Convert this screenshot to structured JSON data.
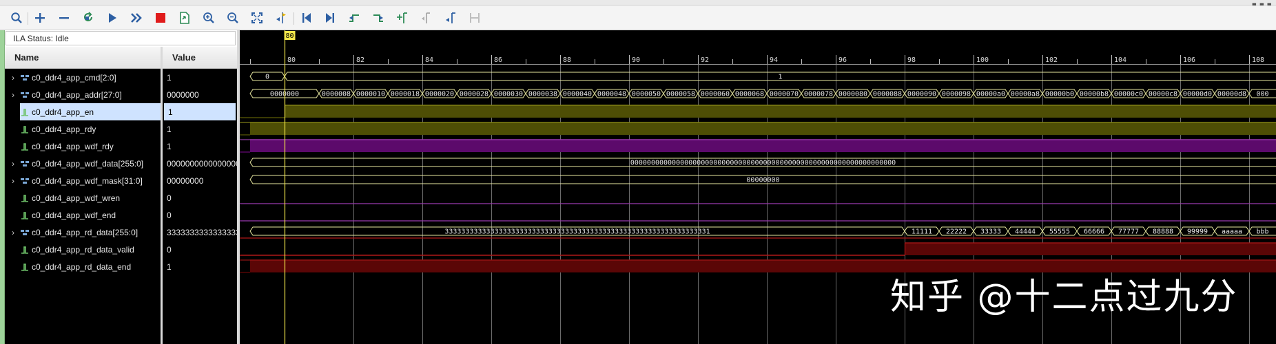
{
  "toolbar": {
    "buttons": [
      {
        "name": "search-icon",
        "tip": "Search"
      },
      {
        "name": "zoom-in-plus-icon",
        "tip": "Add"
      },
      {
        "name": "minus-icon",
        "tip": "Remove"
      },
      {
        "name": "refresh-icon",
        "tip": "Refresh"
      },
      {
        "name": "run-trigger-icon",
        "tip": "Run Trigger"
      },
      {
        "name": "run-immediate-icon",
        "tip": "Run Immediate"
      },
      {
        "name": "stop-icon",
        "tip": "Stop"
      },
      {
        "name": "export-icon",
        "tip": "Export"
      },
      {
        "name": "zoom-in-icon",
        "tip": "Zoom In"
      },
      {
        "name": "zoom-out-icon",
        "tip": "Zoom Out"
      },
      {
        "name": "zoom-fit-icon",
        "tip": "Zoom Fit"
      },
      {
        "name": "go-to-cursor-icon",
        "tip": "Go To Cursor"
      },
      {
        "name": "go-to-start-icon",
        "tip": "Go To Time 0"
      },
      {
        "name": "go-to-end-icon",
        "tip": "Go To Last Time"
      },
      {
        "name": "previous-transition-icon",
        "tip": "Previous Transition"
      },
      {
        "name": "next-transition-icon",
        "tip": "Next Transition"
      },
      {
        "name": "add-marker-icon",
        "tip": "Add Marker"
      },
      {
        "name": "previous-marker-icon",
        "tip": "Previous Marker"
      },
      {
        "name": "next-marker-icon",
        "tip": "Next Marker"
      },
      {
        "name": "swap-cursors-icon",
        "tip": "Swap Cursors"
      }
    ]
  },
  "status": {
    "label": "ILA Status:",
    "value": "Idle"
  },
  "columns": {
    "name": "Name",
    "value": "Value"
  },
  "signals": [
    {
      "name": "c0_ddr4_app_cmd[2:0]",
      "value": "1",
      "bus": true
    },
    {
      "name": "c0_ddr4_app_addr[27:0]",
      "value": "0000000",
      "bus": true
    },
    {
      "name": "c0_ddr4_app_en",
      "value": "1",
      "bus": false,
      "selected": true
    },
    {
      "name": "c0_ddr4_app_rdy",
      "value": "1",
      "bus": false
    },
    {
      "name": "c0_ddr4_app_wdf_rdy",
      "value": "1",
      "bus": false
    },
    {
      "name": "c0_ddr4_app_wdf_data[255:0]",
      "value": "0000000000000000",
      "bus": true
    },
    {
      "name": "c0_ddr4_app_wdf_mask[31:0]",
      "value": "00000000",
      "bus": true
    },
    {
      "name": "c0_ddr4_app_wdf_wren",
      "value": "0",
      "bus": false
    },
    {
      "name": "c0_ddr4_app_wdf_end",
      "value": "0",
      "bus": false
    },
    {
      "name": "c0_ddr4_app_rd_data[255:0]",
      "value": "3333333333333333",
      "bus": true
    },
    {
      "name": "c0_ddr4_app_rd_data_valid",
      "value": "0",
      "bus": false
    },
    {
      "name": "c0_ddr4_app_rd_data_end",
      "value": "1",
      "bus": false
    }
  ],
  "timeline": {
    "cursor_label": "80",
    "tick_labels": [
      "80",
      "82",
      "84",
      "86",
      "88",
      "90",
      "92",
      "94",
      "96",
      "98",
      "100",
      "102",
      "104",
      "106",
      "108"
    ],
    "cursor_sample": 80,
    "first_sample": 80,
    "last_sample": 108
  },
  "waves": {
    "cmd": {
      "segments": [
        {
          "label": "0",
          "from": 79.0,
          "to": 80.0
        },
        {
          "label": "1",
          "from": 80.0,
          "to": 110.0
        }
      ]
    },
    "addr": {
      "segments": [
        {
          "label": "0000000",
          "from": 79.0,
          "to": 81.0
        },
        {
          "label": "0000008",
          "from": 81.0,
          "to": 82.0
        },
        {
          "label": "0000010",
          "from": 82.0,
          "to": 83.0
        },
        {
          "label": "0000018",
          "from": 83.0,
          "to": 84.0
        },
        {
          "label": "0000020",
          "from": 84.0,
          "to": 85.0
        },
        {
          "label": "0000028",
          "from": 85.0,
          "to": 86.0
        },
        {
          "label": "0000030",
          "from": 86.0,
          "to": 87.0
        },
        {
          "label": "0000038",
          "from": 87.0,
          "to": 88.0
        },
        {
          "label": "0000040",
          "from": 88.0,
          "to": 89.0
        },
        {
          "label": "0000048",
          "from": 89.0,
          "to": 90.0
        },
        {
          "label": "0000050",
          "from": 90.0,
          "to": 91.0
        },
        {
          "label": "0000058",
          "from": 91.0,
          "to": 92.0
        },
        {
          "label": "0000060",
          "from": 92.0,
          "to": 93.0
        },
        {
          "label": "0000068",
          "from": 93.0,
          "to": 94.0
        },
        {
          "label": "0000070",
          "from": 94.0,
          "to": 95.0
        },
        {
          "label": "0000078",
          "from": 95.0,
          "to": 96.0
        },
        {
          "label": "0000080",
          "from": 96.0,
          "to": 97.0
        },
        {
          "label": "0000088",
          "from": 97.0,
          "to": 98.0
        },
        {
          "label": "0000090",
          "from": 98.0,
          "to": 99.0
        },
        {
          "label": "0000098",
          "from": 99.0,
          "to": 100.0
        },
        {
          "label": "00000a0",
          "from": 100.0,
          "to": 101.0
        },
        {
          "label": "00000a8",
          "from": 101.0,
          "to": 102.0
        },
        {
          "label": "00000b0",
          "from": 102.0,
          "to": 103.0
        },
        {
          "label": "00000b8",
          "from": 103.0,
          "to": 104.0
        },
        {
          "label": "00000c0",
          "from": 104.0,
          "to": 105.0
        },
        {
          "label": "00000c8",
          "from": 105.0,
          "to": 106.0
        },
        {
          "label": "00000d0",
          "from": 106.0,
          "to": 107.0
        },
        {
          "label": "00000d8",
          "from": 107.0,
          "to": 108.0
        },
        {
          "label": "000",
          "from": 108.0,
          "to": 110.0
        }
      ]
    },
    "en": {
      "high_from": 80.0
    },
    "wdf_data": {
      "label": "0000000000000000000000000000000000000000000000000000000000000000"
    },
    "wdf_mask": {
      "label": "00000000"
    },
    "rd_data": {
      "segments": [
        {
          "label": "3333333333333333333333333333333333333333333333333333333333333331",
          "from": 79.0,
          "to": 98.0
        },
        {
          "label": "11111",
          "from": 98.0,
          "to": 99.0
        },
        {
          "label": "22222",
          "from": 99.0,
          "to": 100.0
        },
        {
          "label": "33333",
          "from": 100.0,
          "to": 101.0
        },
        {
          "label": "44444",
          "from": 101.0,
          "to": 102.0
        },
        {
          "label": "55555",
          "from": 102.0,
          "to": 103.0
        },
        {
          "label": "66666",
          "from": 103.0,
          "to": 104.0
        },
        {
          "label": "77777",
          "from": 104.0,
          "to": 105.0
        },
        {
          "label": "88888",
          "from": 105.0,
          "to": 106.0
        },
        {
          "label": "99999",
          "from": 106.0,
          "to": 107.0
        },
        {
          "label": "aaaaa",
          "from": 107.0,
          "to": 108.0
        },
        {
          "label": "bbb",
          "from": 108.0,
          "to": 110.0
        }
      ]
    },
    "rd_data_valid": {
      "high_from": 98.0
    },
    "rd_data_end": {
      "high_from": 79.0
    }
  },
  "colors": {
    "grid": "#6b6b6b",
    "bus": "#e8e8a0",
    "cursor": "#f2e64a",
    "en": "#4e4e05",
    "rdy": "#4e4e05",
    "wdf_rdy": "#5c0a6b",
    "mask_line": "#9a3bb0",
    "rd_line": "#b01818",
    "rd_valid": "#5a0606",
    "rd_end": "#5a0606"
  },
  "watermark": "知乎 @十二点过九分"
}
